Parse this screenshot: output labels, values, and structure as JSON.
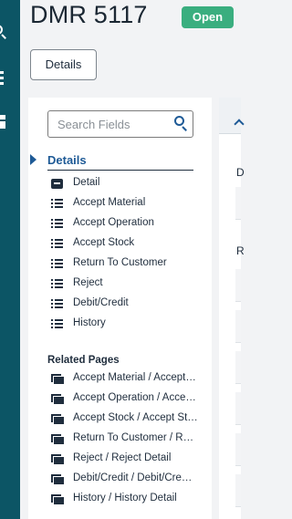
{
  "header": {
    "title": "DMR 5117",
    "status": "Open",
    "status_color": "#3aae7f",
    "details_button": "Details"
  },
  "sidebar": {
    "icons": [
      "search-icon",
      "menu-dots-icon",
      "grid-icon"
    ],
    "background": "#0c5565"
  },
  "panel": {
    "search_placeholder": "Search Fields",
    "section_title": "Details",
    "items": [
      {
        "label": "Detail",
        "icon": "detail-icon"
      },
      {
        "label": "Accept Material",
        "icon": "list-icon"
      },
      {
        "label": "Accept Operation",
        "icon": "list-icon"
      },
      {
        "label": "Accept Stock",
        "icon": "list-icon"
      },
      {
        "label": "Return To Customer",
        "icon": "list-icon"
      },
      {
        "label": "Reject",
        "icon": "list-icon"
      },
      {
        "label": "Debit/Credit",
        "icon": "list-icon"
      },
      {
        "label": "History",
        "icon": "list-icon"
      }
    ],
    "related_title": "Related Pages",
    "related": [
      {
        "label": "Accept Material / Accept…",
        "icon": "pages-icon"
      },
      {
        "label": "Accept Operation / Acce…",
        "icon": "pages-icon"
      },
      {
        "label": "Accept Stock / Accept St…",
        "icon": "pages-icon"
      },
      {
        "label": "Return To Customer / R…",
        "icon": "pages-icon"
      },
      {
        "label": "Reject / Reject Detail",
        "icon": "pages-icon"
      },
      {
        "label": "Debit/Credit / Debit/Cre…",
        "icon": "pages-icon"
      },
      {
        "label": "History / History Detail",
        "icon": "pages-icon"
      }
    ]
  },
  "right": {
    "label1": "D",
    "label2": "R"
  },
  "colors": {
    "accent": "#1e5a96",
    "text": "#1f2d3d"
  }
}
